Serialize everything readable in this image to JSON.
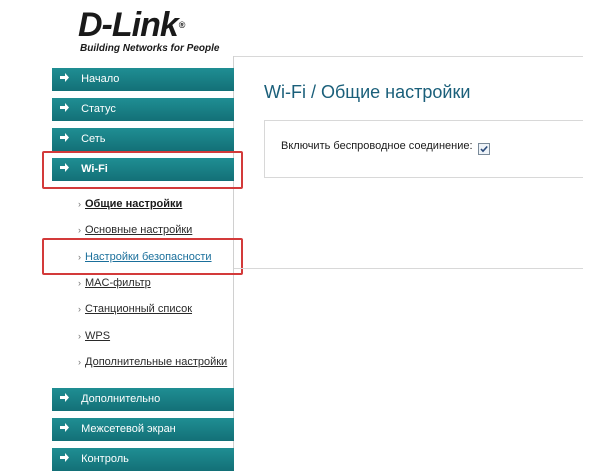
{
  "brand": {
    "name": "D-Link",
    "tagline": "Building Networks for People"
  },
  "sidebar": {
    "items": [
      {
        "label": "Начало"
      },
      {
        "label": "Статус"
      },
      {
        "label": "Сеть"
      },
      {
        "label": "Wi-Fi"
      },
      {
        "label": "Дополнительно"
      },
      {
        "label": "Межсетевой экран"
      },
      {
        "label": "Контроль"
      }
    ],
    "wifi_subitems": [
      {
        "label": "Общие настройки"
      },
      {
        "label": "Основные настройки"
      },
      {
        "label": "Настройки безопасности"
      },
      {
        "label": "MAC-фильтр"
      },
      {
        "label": "Станционный список"
      },
      {
        "label": "WPS"
      },
      {
        "label": "Дополнительные настройки"
      }
    ]
  },
  "main": {
    "title": "Wi-Fi /  Общие настройки",
    "enable_wireless_label": "Включить беспроводное соединение:",
    "enable_wireless_checked": true
  },
  "colors": {
    "nav_bg": "#137077",
    "highlight": "#d33a3a",
    "title": "#1a5f7a"
  }
}
